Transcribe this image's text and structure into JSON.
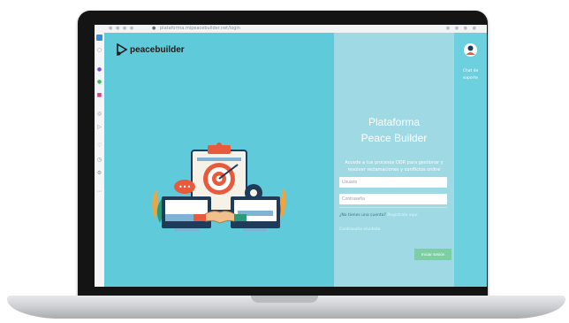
{
  "browser": {
    "url": "plataforma.mipeacebuilder.net/login"
  },
  "brand": {
    "name": "peacebuilder"
  },
  "login": {
    "title_line1": "Plataforma",
    "title_line2": "Peace Builder",
    "description": "Accede a tus procesos ODR para gestionar y resolver reclamaciones y conflictos online",
    "username_placeholder": "Usuario",
    "password_placeholder": "Contraseña",
    "signup_text": "¿No tienes una cuenta?",
    "signup_link": "Regístrate aquí",
    "forgot_link": "Contraseña olvidada",
    "submit_label": "Iniciar sesión"
  },
  "support": {
    "label": "Chat de soporte"
  },
  "colors": {
    "background": "#5fcad9",
    "panel": "#9ed9e4",
    "submit": "#7ccfa0"
  }
}
